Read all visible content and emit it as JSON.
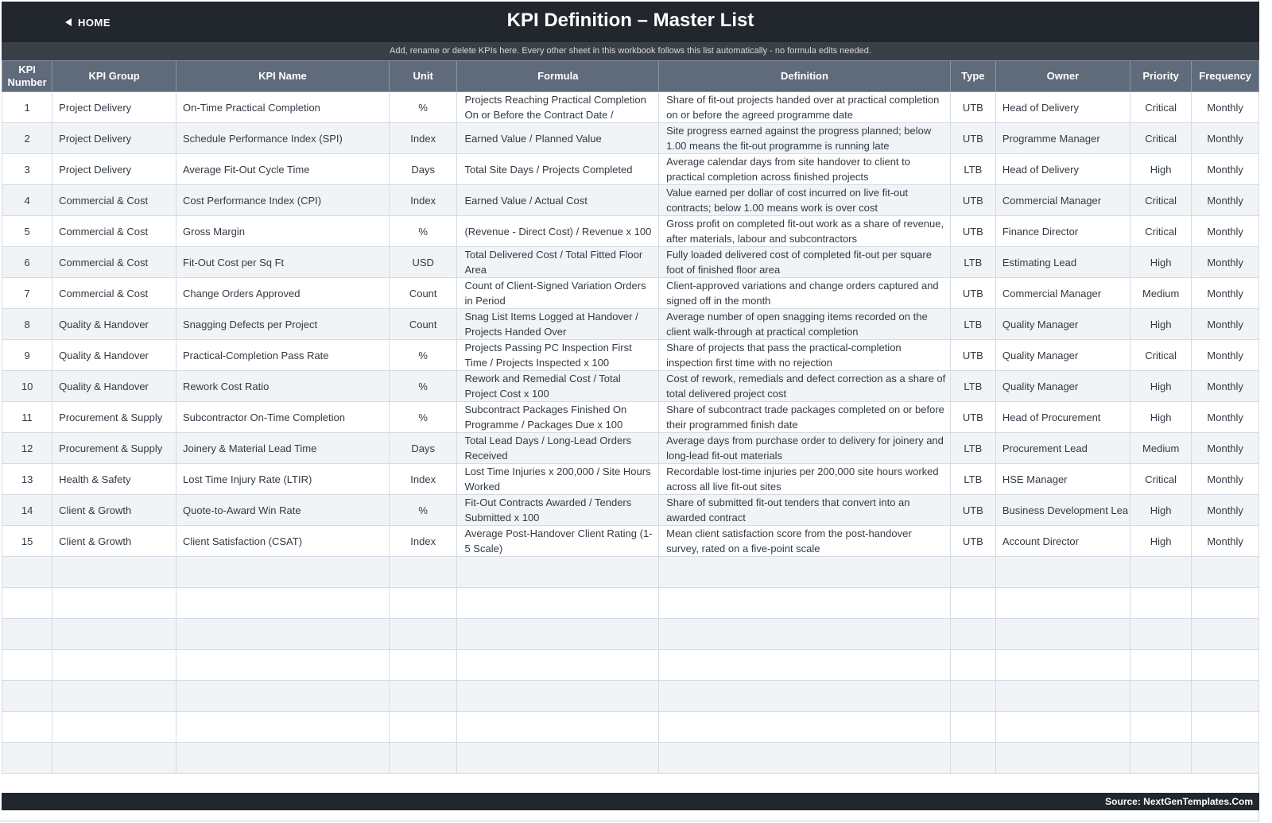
{
  "header": {
    "home_label": "HOME",
    "title": "KPI Definition  –  Master List",
    "subtitle": "Add, rename or delete KPIs here. Every other sheet in this workbook follows this list automatically - no formula edits needed."
  },
  "columns": [
    "KPI Number",
    "KPI Group",
    "KPI Name",
    "Unit",
    "Formula",
    "Definition",
    "Type",
    "Owner",
    "Priority",
    "Frequency"
  ],
  "rows": [
    {
      "num": "1",
      "group": "Project Delivery",
      "name": "On-Time Practical Completion",
      "unit": "%",
      "formula": "Projects Reaching Practical Completion On or Before the Contract Date /",
      "definition": "Share of fit-out projects handed over at practical completion on or before the agreed programme date",
      "type": "UTB",
      "owner": "Head of Delivery",
      "priority": "Critical",
      "frequency": "Monthly"
    },
    {
      "num": "2",
      "group": "Project Delivery",
      "name": "Schedule Performance Index (SPI)",
      "unit": "Index",
      "formula": "Earned Value / Planned Value",
      "definition": "Site progress earned against the progress planned; below 1.00 means the fit-out programme is running late",
      "type": "UTB",
      "owner": "Programme Manager",
      "priority": "Critical",
      "frequency": "Monthly"
    },
    {
      "num": "3",
      "group": "Project Delivery",
      "name": "Average Fit-Out Cycle Time",
      "unit": "Days",
      "formula": "Total Site Days / Projects Completed",
      "definition": "Average calendar days from site handover to client to practical completion across finished projects",
      "type": "LTB",
      "owner": "Head of Delivery",
      "priority": "High",
      "frequency": "Monthly"
    },
    {
      "num": "4",
      "group": "Commercial & Cost",
      "name": "Cost Performance Index (CPI)",
      "unit": "Index",
      "formula": "Earned Value / Actual Cost",
      "definition": "Value earned per dollar of cost incurred on live fit-out contracts; below 1.00 means work is over cost",
      "type": "UTB",
      "owner": "Commercial Manager",
      "priority": "Critical",
      "frequency": "Monthly"
    },
    {
      "num": "5",
      "group": "Commercial & Cost",
      "name": "Gross Margin",
      "unit": "%",
      "formula": "(Revenue - Direct Cost) / Revenue x 100",
      "definition": "Gross profit on completed fit-out work as a share of revenue, after materials, labour and subcontractors",
      "type": "UTB",
      "owner": "Finance Director",
      "priority": "Critical",
      "frequency": "Monthly"
    },
    {
      "num": "6",
      "group": "Commercial & Cost",
      "name": "Fit-Out Cost per Sq Ft",
      "unit": "USD",
      "formula": "Total Delivered Cost / Total Fitted Floor Area",
      "definition": "Fully loaded delivered cost of completed fit-out per square foot of finished floor area",
      "type": "LTB",
      "owner": "Estimating Lead",
      "priority": "High",
      "frequency": "Monthly"
    },
    {
      "num": "7",
      "group": "Commercial & Cost",
      "name": "Change Orders Approved",
      "unit": "Count",
      "formula": "Count of Client-Signed Variation Orders in Period",
      "definition": "Client-approved variations and change orders captured and signed off in the month",
      "type": "UTB",
      "owner": "Commercial Manager",
      "priority": "Medium",
      "frequency": "Monthly"
    },
    {
      "num": "8",
      "group": "Quality & Handover",
      "name": "Snagging Defects per Project",
      "unit": "Count",
      "formula": "Snag List Items Logged at Handover / Projects Handed Over",
      "definition": "Average number of open snagging items recorded on the client walk-through at practical completion",
      "type": "LTB",
      "owner": "Quality Manager",
      "priority": "High",
      "frequency": "Monthly"
    },
    {
      "num": "9",
      "group": "Quality & Handover",
      "name": "Practical-Completion Pass Rate",
      "unit": "%",
      "formula": "Projects Passing PC Inspection First Time / Projects Inspected x 100",
      "definition": "Share of projects that pass the practical-completion inspection first time with no rejection",
      "type": "UTB",
      "owner": "Quality Manager",
      "priority": "Critical",
      "frequency": "Monthly"
    },
    {
      "num": "10",
      "group": "Quality & Handover",
      "name": "Rework Cost Ratio",
      "unit": "%",
      "formula": "Rework and Remedial Cost / Total Project Cost x 100",
      "definition": "Cost of rework, remedials and defect correction as a share of total delivered project cost",
      "type": "LTB",
      "owner": "Quality Manager",
      "priority": "High",
      "frequency": "Monthly"
    },
    {
      "num": "11",
      "group": "Procurement & Supply",
      "name": "Subcontractor On-Time Completion",
      "unit": "%",
      "formula": "Subcontract Packages Finished On Programme / Packages Due x 100",
      "definition": "Share of subcontract trade packages completed on or before their programmed finish date",
      "type": "UTB",
      "owner": "Head of Procurement",
      "priority": "High",
      "frequency": "Monthly"
    },
    {
      "num": "12",
      "group": "Procurement & Supply",
      "name": "Joinery & Material Lead Time",
      "unit": "Days",
      "formula": "Total Lead Days / Long-Lead Orders Received",
      "definition": "Average days from purchase order to delivery for joinery and long-lead fit-out materials",
      "type": "LTB",
      "owner": "Procurement Lead",
      "priority": "Medium",
      "frequency": "Monthly"
    },
    {
      "num": "13",
      "group": "Health & Safety",
      "name": "Lost Time Injury Rate (LTIR)",
      "unit": "Index",
      "formula": "Lost Time Injuries x 200,000 / Site Hours Worked",
      "definition": "Recordable lost-time injuries per 200,000 site hours worked across all live fit-out sites",
      "type": "LTB",
      "owner": "HSE Manager",
      "priority": "Critical",
      "frequency": "Monthly"
    },
    {
      "num": "14",
      "group": "Client & Growth",
      "name": "Quote-to-Award Win Rate",
      "unit": "%",
      "formula": "Fit-Out Contracts Awarded / Tenders Submitted x 100",
      "definition": "Share of submitted fit-out tenders that convert into an awarded contract",
      "type": "UTB",
      "owner": "Business Development Lea",
      "priority": "High",
      "frequency": "Monthly"
    },
    {
      "num": "15",
      "group": "Client & Growth",
      "name": "Client Satisfaction (CSAT)",
      "unit": "Index",
      "formula": "Average Post-Handover Client Rating (1-5 Scale)",
      "definition": "Mean client satisfaction score from the post-handover survey, rated on a five-point scale",
      "type": "UTB",
      "owner": "Account Director",
      "priority": "High",
      "frequency": "Monthly"
    }
  ],
  "empty_row_count": 7,
  "footer": {
    "source": "Source: NextGenTemplates.Com"
  },
  "colors": {
    "title_bar": "#22272d",
    "sub_bar": "#3a4048",
    "header": "#5f6b7a",
    "stripe": "#f1f4f7"
  }
}
